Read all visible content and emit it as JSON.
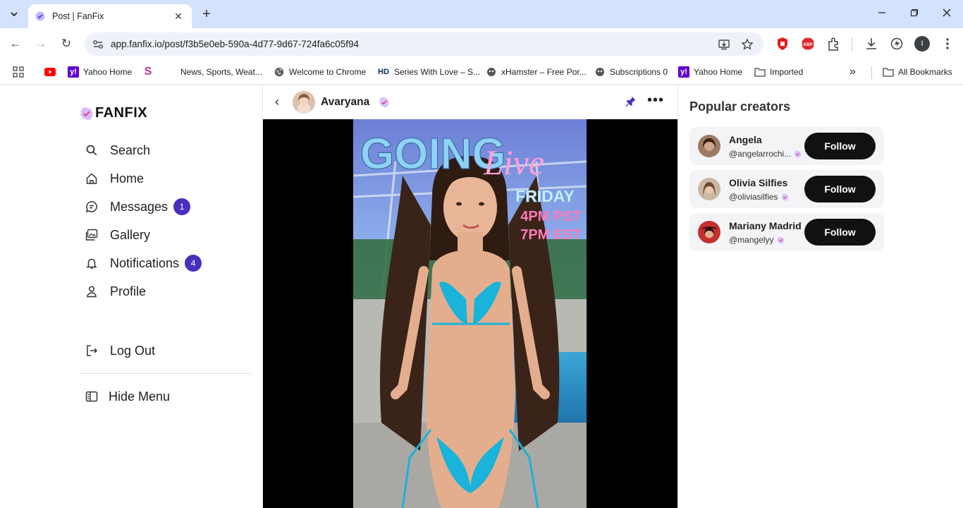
{
  "browser": {
    "tab_title": "Post | FanFix",
    "tab_close": "✕",
    "new_tab": "+",
    "url": "app.fanfix.io/post/f3b5e0eb-590a-4d77-9d67-724fa6c05f94",
    "window_controls": {
      "minimize": "—",
      "maximize": "❐",
      "close": "✕"
    },
    "nav": {
      "back": "←",
      "forward": "→",
      "reload": "↻"
    }
  },
  "bookmarks": [
    {
      "label": "",
      "icon": "youtube-icon"
    },
    {
      "label": "Yahoo Home",
      "icon": "yahoo-icon"
    },
    {
      "label": "",
      "icon": "s-icon"
    },
    {
      "label": "News, Sports, Weat...",
      "icon": "blank-icon"
    },
    {
      "label": "Welcome to Chrome",
      "icon": "chrome-icon"
    },
    {
      "label": "Series With Love – S...",
      "icon": "hd-icon"
    },
    {
      "label": "xHamster – Free Por...",
      "icon": "xhamster-icon"
    },
    {
      "label": "Subscriptions 0",
      "icon": "xhamster-icon"
    },
    {
      "label": "Yahoo Home",
      "icon": "yahoo-icon"
    },
    {
      "label": "Imported",
      "icon": "folder-icon"
    },
    {
      "label": "All Bookmarks",
      "icon": "folder-icon"
    }
  ],
  "bookmarks_overflow": "»",
  "app": {
    "logo_text": "FANFIX",
    "nav": {
      "search": "Search",
      "home": "Home",
      "messages": "Messages",
      "messages_badge": "1",
      "gallery": "Gallery",
      "notifications": "Notifications",
      "notifications_badge": "4",
      "profile": "Profile",
      "logout": "Log Out",
      "hide_menu": "Hide Menu"
    }
  },
  "post": {
    "back": "‹",
    "creator_name": "Avaryana",
    "more": "•••",
    "image_text": {
      "line1": "GOING",
      "line2": "Live",
      "line3": "FRIDAY",
      "line4": "4PM PST",
      "line5": "7PM EST"
    }
  },
  "sidebar": {
    "heading": "Popular creators",
    "creators": [
      {
        "name": "Angela",
        "handle": "@angelarrochi...",
        "follow": "Follow"
      },
      {
        "name": "Olivia Silfies",
        "handle": "@oliviasilfies",
        "follow": "Follow"
      },
      {
        "name": "Mariany Madrid",
        "handle": "@mangelyy",
        "follow": "Follow"
      }
    ]
  },
  "colors": {
    "accent": "#4a2fbd",
    "tabbar": "#d3e3fd",
    "follow_button": "#111111",
    "verified": "#c8a6ff"
  }
}
